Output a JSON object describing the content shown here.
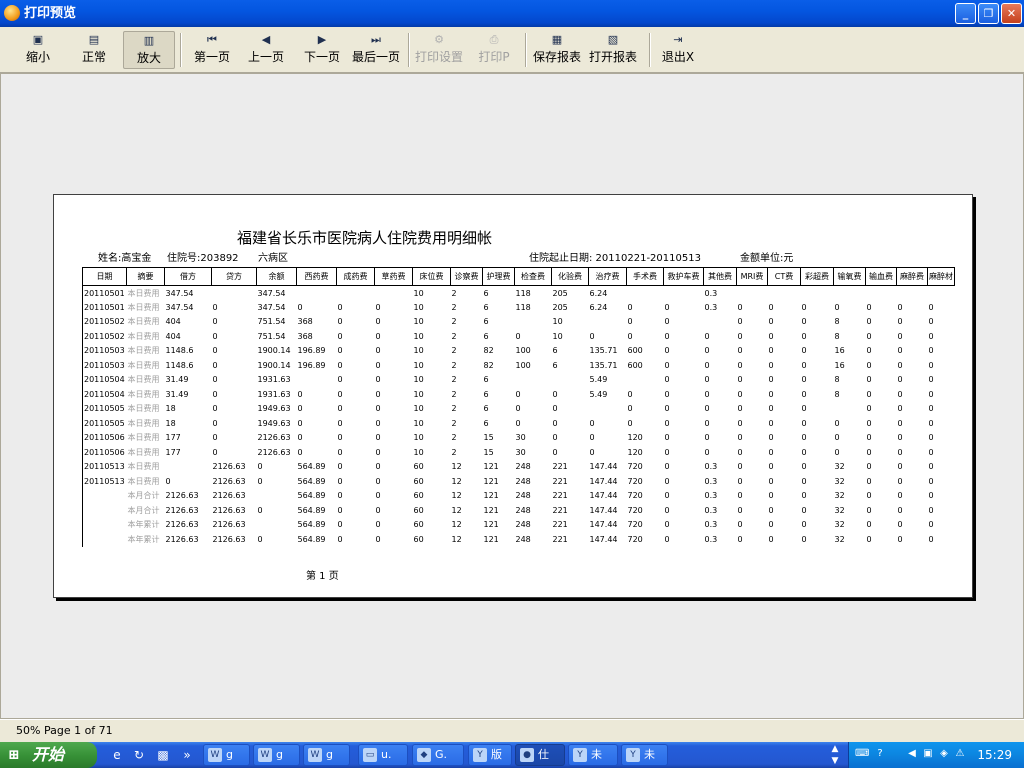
{
  "window": {
    "title": "打印预览",
    "min": "_",
    "max": "❐",
    "close": "✕"
  },
  "toolbar": [
    {
      "label": "缩小",
      "icon": "zoom-out-icon",
      "glyph": "▣",
      "enabled": true
    },
    {
      "label": "正常",
      "icon": "normal-view-icon",
      "glyph": "▤",
      "enabled": true
    },
    {
      "label": "放大",
      "icon": "zoom-in-icon",
      "glyph": "▥",
      "enabled": true,
      "pressed": true
    },
    {
      "label": "第一页",
      "icon": "first-page-icon",
      "glyph": "⏮",
      "enabled": true
    },
    {
      "label": "上一页",
      "icon": "prev-page-icon",
      "glyph": "◀",
      "enabled": true
    },
    {
      "label": "下一页",
      "icon": "next-page-icon",
      "glyph": "▶",
      "enabled": true
    },
    {
      "label": "最后一页",
      "icon": "last-page-icon",
      "glyph": "⏭",
      "enabled": true
    },
    {
      "label": "打印设置",
      "icon": "print-setup-icon",
      "glyph": "⚙",
      "enabled": false
    },
    {
      "label": "打印P",
      "icon": "printer-icon",
      "glyph": "⎙",
      "enabled": false
    },
    {
      "label": "保存报表",
      "icon": "save-icon",
      "glyph": "▦",
      "enabled": true
    },
    {
      "label": "打开报表",
      "icon": "open-folder-icon",
      "glyph": "▧",
      "enabled": true
    },
    {
      "label": "退出X",
      "icon": "exit-icon",
      "glyph": "⇥",
      "enabled": true
    }
  ],
  "report": {
    "title": "福建省长乐市医院病人住院费用明细帐",
    "name": "姓名:高宝金",
    "admission": "住院号:203892",
    "ward": "六病区",
    "period": "住院起止日期: 20110221-20110513",
    "unit": "金额单位:元",
    "page_label": "第 1 页",
    "columns": [
      "日期",
      "摘要",
      "借方",
      "贷方",
      "余额",
      "西药费",
      "成药费",
      "草药费",
      "床位费",
      "诊察费",
      "护理费",
      "检查费",
      "化验费",
      "治疗费",
      "手术费",
      "救护车费",
      "其他费",
      "MRI费",
      "CT费",
      "彩超费",
      "输氧费",
      "输血费",
      "麻醉费",
      "麻醉材"
    ],
    "rows": [
      [
        "20110501",
        "本日费用",
        "347.54",
        "",
        "347.54",
        "",
        "",
        "",
        "10",
        "2",
        "6",
        "118",
        "205",
        "6.24",
        "",
        "",
        "0.3",
        "",
        "",
        "",
        "",
        "",
        "",
        ""
      ],
      [
        "20110501",
        "本日费用",
        "347.54",
        "0",
        "347.54",
        "0",
        "0",
        "0",
        "10",
        "2",
        "6",
        "118",
        "205",
        "6.24",
        "0",
        "0",
        "0.3",
        "0",
        "0",
        "0",
        "0",
        "0",
        "0",
        "0"
      ],
      [
        "20110502",
        "本日费用",
        "404",
        "0",
        "751.54",
        "368",
        "0",
        "0",
        "10",
        "2",
        "6",
        "",
        "10",
        "",
        "0",
        "0",
        "",
        "0",
        "0",
        "0",
        "8",
        "0",
        "0",
        "0"
      ],
      [
        "20110502",
        "本日费用",
        "404",
        "0",
        "751.54",
        "368",
        "0",
        "0",
        "10",
        "2",
        "6",
        "0",
        "10",
        "0",
        "0",
        "0",
        "0",
        "0",
        "0",
        "0",
        "8",
        "0",
        "0",
        "0"
      ],
      [
        "20110503",
        "本日费用",
        "1148.6",
        "0",
        "1900.14",
        "196.89",
        "0",
        "0",
        "10",
        "2",
        "82",
        "100",
        "6",
        "135.71",
        "600",
        "0",
        "0",
        "0",
        "0",
        "0",
        "16",
        "0",
        "0",
        "0"
      ],
      [
        "20110503",
        "本日费用",
        "1148.6",
        "0",
        "1900.14",
        "196.89",
        "0",
        "0",
        "10",
        "2",
        "82",
        "100",
        "6",
        "135.71",
        "600",
        "0",
        "0",
        "0",
        "0",
        "0",
        "16",
        "0",
        "0",
        "0"
      ],
      [
        "20110504",
        "本日费用",
        "31.49",
        "0",
        "1931.63",
        "",
        "0",
        "0",
        "10",
        "2",
        "6",
        "",
        "",
        "5.49",
        "",
        "0",
        "0",
        "0",
        "0",
        "0",
        "8",
        "0",
        "0",
        "0"
      ],
      [
        "20110504",
        "本日费用",
        "31.49",
        "0",
        "1931.63",
        "0",
        "0",
        "0",
        "10",
        "2",
        "6",
        "0",
        "0",
        "5.49",
        "0",
        "0",
        "0",
        "0",
        "0",
        "0",
        "8",
        "0",
        "0",
        "0"
      ],
      [
        "20110505",
        "本日费用",
        "18",
        "0",
        "1949.63",
        "0",
        "0",
        "0",
        "10",
        "2",
        "6",
        "0",
        "0",
        "",
        "0",
        "0",
        "0",
        "0",
        "0",
        "0",
        "",
        "0",
        "0",
        "0"
      ],
      [
        "20110505",
        "本日费用",
        "18",
        "0",
        "1949.63",
        "0",
        "0",
        "0",
        "10",
        "2",
        "6",
        "0",
        "0",
        "0",
        "0",
        "0",
        "0",
        "0",
        "0",
        "0",
        "0",
        "0",
        "0",
        "0"
      ],
      [
        "20110506",
        "本日费用",
        "177",
        "0",
        "2126.63",
        "0",
        "0",
        "0",
        "10",
        "2",
        "15",
        "30",
        "0",
        "0",
        "120",
        "0",
        "0",
        "0",
        "0",
        "0",
        "0",
        "0",
        "0",
        "0"
      ],
      [
        "20110506",
        "本日费用",
        "177",
        "0",
        "2126.63",
        "0",
        "0",
        "0",
        "10",
        "2",
        "15",
        "30",
        "0",
        "0",
        "120",
        "0",
        "0",
        "0",
        "0",
        "0",
        "0",
        "0",
        "0",
        "0"
      ],
      [
        "20110513",
        "本日费用",
        "",
        "2126.63",
        "0",
        "564.89",
        "0",
        "0",
        "60",
        "12",
        "121",
        "248",
        "221",
        "147.44",
        "720",
        "0",
        "0.3",
        "0",
        "0",
        "0",
        "32",
        "0",
        "0",
        "0"
      ],
      [
        "20110513",
        "本日费用",
        "0",
        "2126.63",
        "0",
        "564.89",
        "0",
        "0",
        "60",
        "12",
        "121",
        "248",
        "221",
        "147.44",
        "720",
        "0",
        "0.3",
        "0",
        "0",
        "0",
        "32",
        "0",
        "0",
        "0"
      ],
      [
        "",
        "本月合计",
        "2126.63",
        "2126.63",
        "",
        "564.89",
        "0",
        "0",
        "60",
        "12",
        "121",
        "248",
        "221",
        "147.44",
        "720",
        "0",
        "0.3",
        "0",
        "0",
        "0",
        "32",
        "0",
        "0",
        "0"
      ],
      [
        "",
        "本月合计",
        "2126.63",
        "2126.63",
        "0",
        "564.89",
        "0",
        "0",
        "60",
        "12",
        "121",
        "248",
        "221",
        "147.44",
        "720",
        "0",
        "0.3",
        "0",
        "0",
        "0",
        "32",
        "0",
        "0",
        "0"
      ],
      [
        "",
        "本年累计",
        "2126.63",
        "2126.63",
        "",
        "564.89",
        "0",
        "0",
        "60",
        "12",
        "121",
        "248",
        "221",
        "147.44",
        "720",
        "0",
        "0.3",
        "0",
        "0",
        "0",
        "32",
        "0",
        "0",
        "0"
      ],
      [
        "",
        "本年累计",
        "2126.63",
        "2126.63",
        "0",
        "564.89",
        "0",
        "0",
        "60",
        "12",
        "121",
        "248",
        "221",
        "147.44",
        "720",
        "0",
        "0.3",
        "0",
        "0",
        "0",
        "32",
        "0",
        "0",
        "0"
      ]
    ]
  },
  "status": {
    "zoom": "50%",
    "page": "Page 1 of 71"
  },
  "taskbar": {
    "start": "开始",
    "quicklaunch": [
      {
        "icon": "ie-icon",
        "glyph": "e"
      },
      {
        "icon": "refresh-icon",
        "glyph": "↻"
      },
      {
        "icon": "image-icon",
        "glyph": "▩"
      },
      {
        "icon": "more-icon",
        "glyph": "»"
      }
    ],
    "tasks": [
      {
        "label": "g",
        "icon": "word-icon",
        "glyph": "W",
        "active": false
      },
      {
        "label": "g",
        "icon": "word-icon",
        "glyph": "W",
        "active": false
      },
      {
        "label": "g",
        "icon": "word-icon",
        "glyph": "W",
        "active": false
      },
      {
        "label": "u.",
        "icon": "folder-icon",
        "glyph": "▭",
        "active": false
      },
      {
        "label": "G.",
        "icon": "app-icon",
        "glyph": "◆",
        "active": false
      },
      {
        "label": "版",
        "icon": "app-icon",
        "glyph": "Y",
        "active": false
      },
      {
        "label": "仕",
        "icon": "app-icon",
        "glyph": "●",
        "active": true
      },
      {
        "label": "未",
        "icon": "app-icon",
        "glyph": "Y",
        "active": false
      },
      {
        "label": "未",
        "icon": "app-icon",
        "glyph": "Y",
        "active": false
      }
    ],
    "clock": "15:29"
  }
}
